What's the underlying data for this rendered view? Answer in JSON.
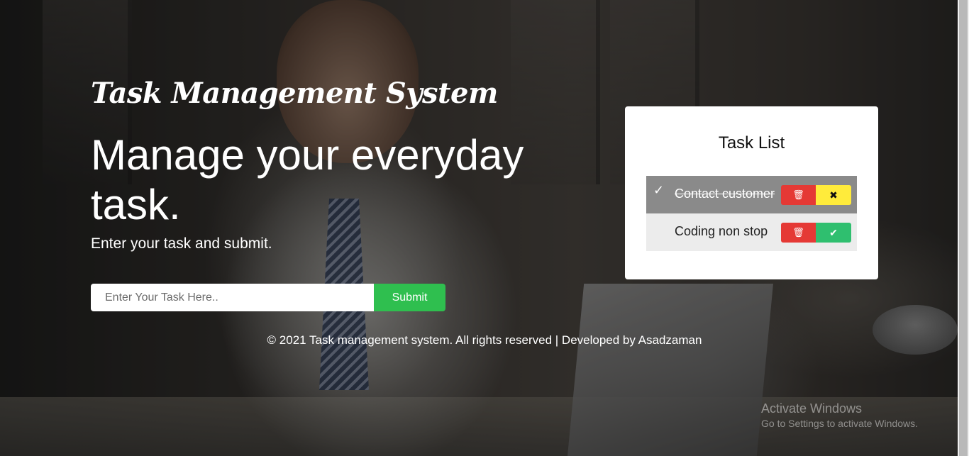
{
  "hero": {
    "brand_title": "Task Management System",
    "headline": "Manage your everyday task.",
    "subline": "Enter your task and submit."
  },
  "form": {
    "input_placeholder": "Enter Your Task Here..",
    "input_value": "",
    "submit_label": "Submit"
  },
  "task_list": {
    "title": "Task List",
    "items": [
      {
        "text": "Contact customer",
        "status": "done",
        "check_icon": "check-icon",
        "delete_icon": "trash-icon",
        "toggle_icon": "close-icon"
      },
      {
        "text": "Coding non stop",
        "status": "pending",
        "delete_icon": "trash-icon",
        "toggle_icon": "check-icon"
      }
    ]
  },
  "footer": {
    "text": "© 2021 Task management system. All rights reserved | Developed by Asadzaman"
  },
  "watermark": {
    "line1": "Activate Windows",
    "line2": "Go to Settings to activate Windows."
  },
  "colors": {
    "submit_green": "#2fbf4f",
    "delete_red": "#e53935",
    "undo_yellow": "#ffeb3b",
    "complete_green": "#2fbf6f",
    "done_row_gray": "#8a8a8a",
    "pending_row_gray": "#ececec"
  }
}
